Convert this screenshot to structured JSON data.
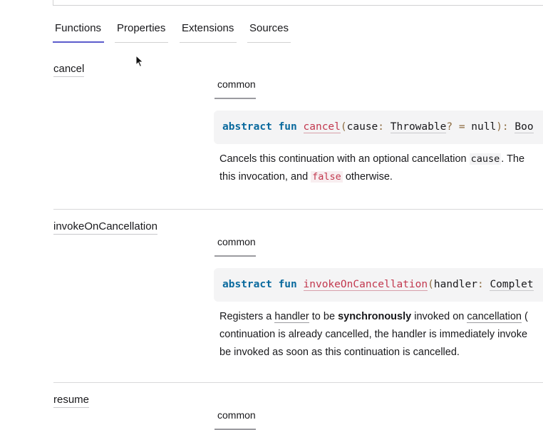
{
  "tabs": [
    {
      "label": "Functions",
      "active": true
    },
    {
      "label": "Properties",
      "active": false
    },
    {
      "label": "Extensions",
      "active": false
    },
    {
      "label": "Sources",
      "active": false
    }
  ],
  "members": [
    {
      "name": "cancel",
      "platform": "common",
      "signature": {
        "keyword1": "abstract",
        "keyword2": "fun",
        "fn_name": "cancel",
        "open_paren": "(",
        "param": "cause",
        "colon": ":",
        "type": "Throwable",
        "nullable": "?",
        "eq": "=",
        "default": "null",
        "close": "):",
        "return_type": "Boo"
      },
      "description": {
        "line1_a": "Cancels this continuation with an optional cancellation ",
        "line1_code": "cause",
        "line1_b": ". The",
        "line2_a": "this invocation, and ",
        "line2_code": "false",
        "line2_b": " otherwise."
      }
    },
    {
      "name": "invokeOnCancellation",
      "platform": "common",
      "signature": {
        "keyword1": "abstract",
        "keyword2": "fun",
        "fn_name": "invokeOnCancellation",
        "open_paren": "(",
        "param": "handler",
        "colon": ":",
        "type": "Complet"
      },
      "description": {
        "line1_a": "Registers a ",
        "line1_link1": "handler",
        "line1_b": " to be ",
        "line1_bold": "synchronously",
        "line1_c": " invoked on ",
        "line1_link2": "cancellation",
        "line1_d": " (",
        "line2": "continuation is already cancelled, the handler is immediately invoke",
        "line3": "be invoked as soon as this continuation is cancelled."
      }
    },
    {
      "name": "resume",
      "platform": "common"
    }
  ],
  "colors": {
    "accent": "#5c5ccc",
    "keyword": "#0a6a9e",
    "function_name": "#c2384e",
    "code_bg": "#f4f4f5"
  }
}
